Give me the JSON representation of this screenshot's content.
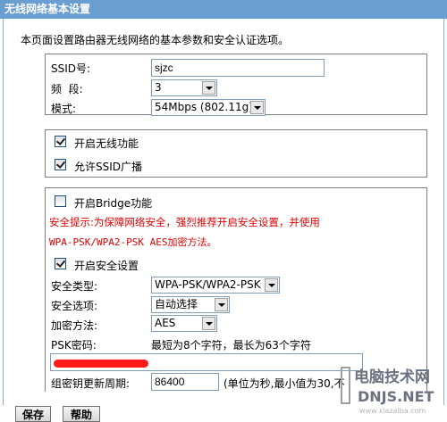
{
  "window": {
    "title": "无线网络基本设置"
  },
  "description": "本页面设置路由器无线网络的基本参数和安全认证选项。",
  "basic": {
    "ssid_label": "SSID号:",
    "ssid_value": "sjzc",
    "channel_label": "频  段:",
    "channel_value": "3",
    "mode_label": "模式:",
    "mode_value": "54Mbps (802.11g)"
  },
  "wireless": {
    "enable_label": "开启无线功能",
    "enable_checked": true,
    "broadcast_label": "允许SSID广播",
    "broadcast_checked": true
  },
  "security": {
    "bridge_label": "开启Bridge功能",
    "bridge_checked": false,
    "tip_line1": "安全提示:为保障网络安全，强烈推荐开启安全设置，并使用",
    "tip_line2": "WPA-PSK/WPA2-PSK AES加密方法。",
    "enable_security_label": "开启安全设置",
    "enable_security_checked": true,
    "type_label": "安全类型:",
    "type_value": "WPA-PSK/WPA2-PSK",
    "option_label": "安全选项:",
    "option_value": "自动选择",
    "encryption_label": "加密方法:",
    "encryption_value": "AES",
    "psk_label": "PSK密码:",
    "psk_hint": "最短为8个字符，最长为63个字符",
    "rekey_label": "组密钥更新周期:",
    "rekey_value": "86400",
    "rekey_hint": "(单位为秒,最小值为30,不"
  },
  "buttons": {
    "save": "保存",
    "help": "帮助"
  },
  "watermark": {
    "line1": "电脑技术网",
    "line2": "DNJS.NET",
    "line3": "www.xiazaiba.com"
  },
  "colors": {
    "titlebar": "#6a9ed0",
    "warning": "#e00000",
    "border": "#808080"
  }
}
